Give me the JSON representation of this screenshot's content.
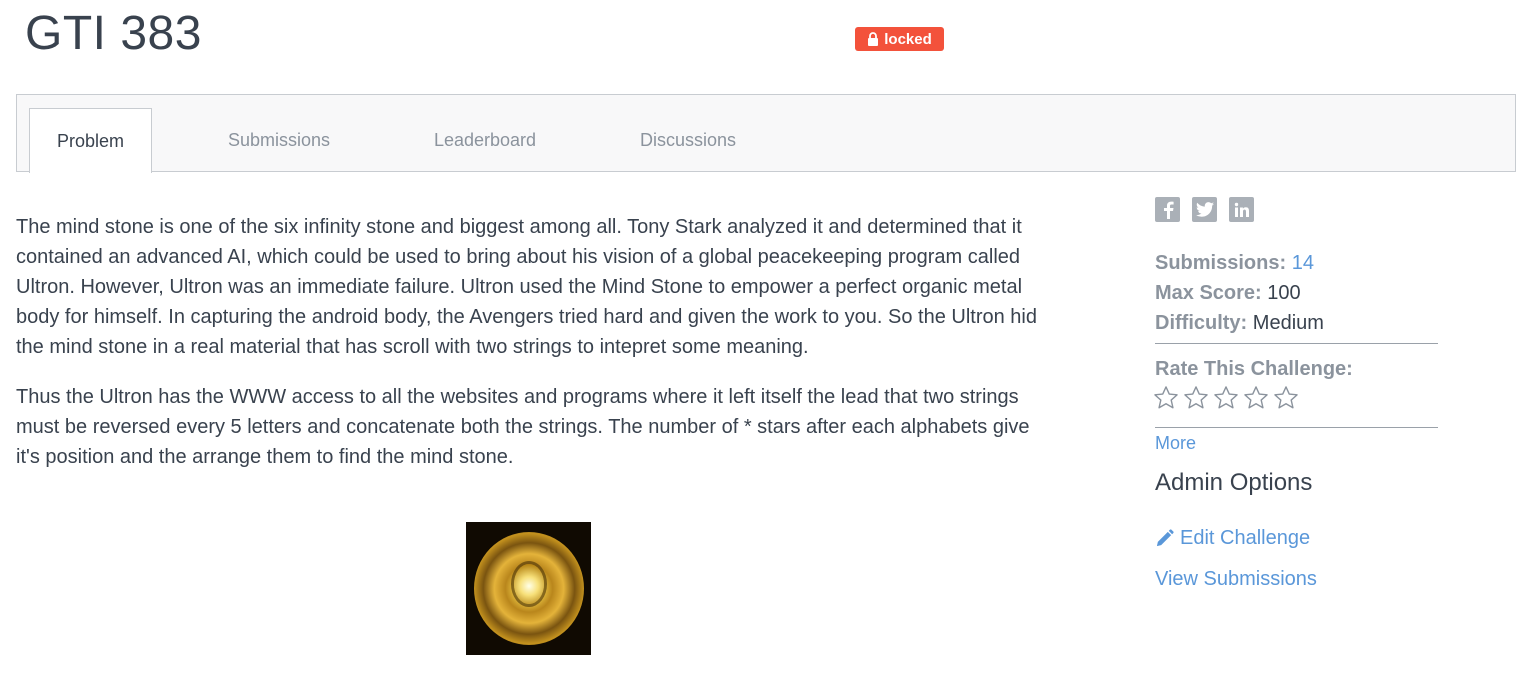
{
  "header": {
    "title": "GTI 383",
    "badge": "locked"
  },
  "tabs": [
    {
      "label": "Problem",
      "active": true
    },
    {
      "label": "Submissions",
      "active": false
    },
    {
      "label": "Leaderboard",
      "active": false
    },
    {
      "label": "Discussions",
      "active": false
    }
  ],
  "problem": {
    "paragraphs": [
      "The mind stone is one of the six infinity stone and biggest among all. Tony Stark analyzed it and determined that it contained an advanced AI, which could be used to bring about his vision of a global peacekeeping program called Ultron. However, Ultron was an immediate failure. Ultron used the Mind Stone to empower a perfect organic metal body for himself. In capturing the android body, the Avengers tried hard and given the work to you. So the Ultron hid the mind stone in a real material that has scroll with two strings to intepret some meaning.",
      "Thus the Ultron has the WWW access to all the websites and programs where it left itself the lead that two strings must be reversed every 5 letters and concatenate both the strings. The number of * stars after each alphabets give it's position and the arrange them to find the mind stone."
    ]
  },
  "sidebar": {
    "social_icons": [
      "facebook-icon",
      "twitter-icon",
      "linkedin-icon"
    ],
    "submissions_label": "Submissions:",
    "submissions_value": "14",
    "max_score_label": "Max Score:",
    "max_score_value": "100",
    "difficulty_label": "Difficulty:",
    "difficulty_value": "Medium",
    "rate_label": "Rate This Challenge:",
    "rating": 0,
    "rating_max": 5,
    "more_label": "More",
    "admin_title": "Admin Options",
    "edit_label": "Edit Challenge",
    "view_submissions_label": "View Submissions"
  },
  "colors": {
    "badge": "#f3523b",
    "link": "#5a97d9",
    "muted": "#8b939d",
    "text": "#39424e"
  }
}
